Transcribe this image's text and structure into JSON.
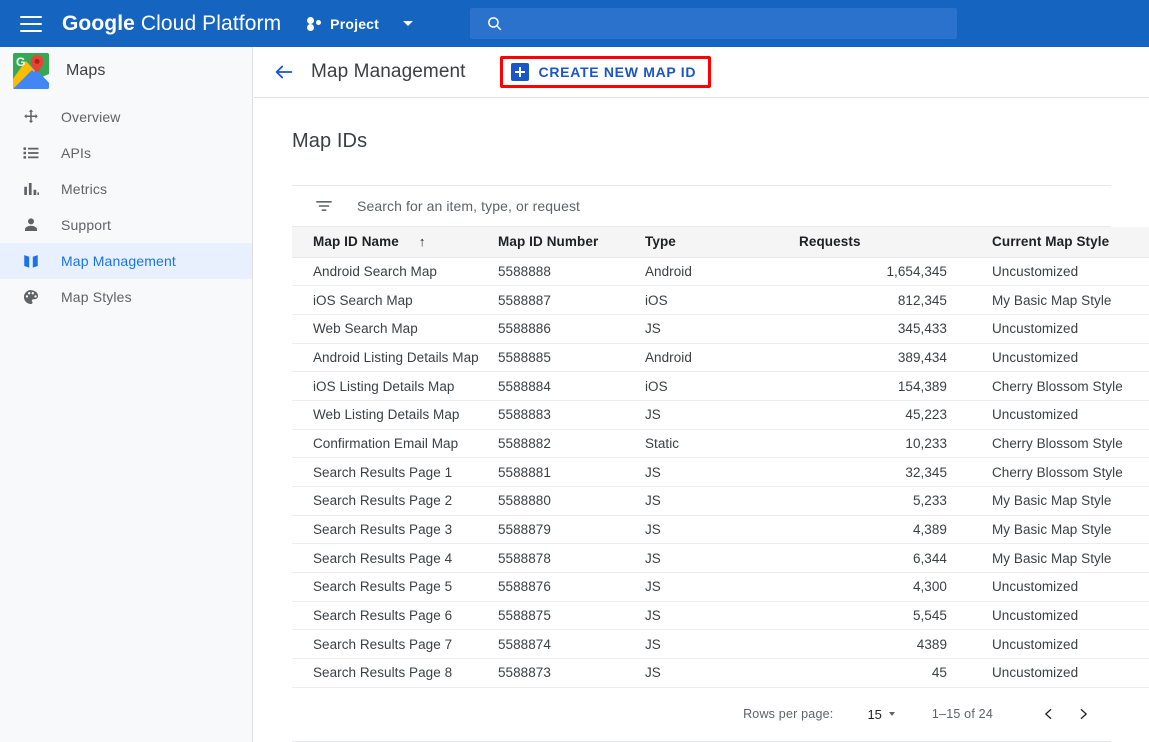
{
  "topbar": {
    "menu_icon": "hamburger-menu-icon",
    "brand_bold": "Google",
    "brand_normal": "Cloud Platform",
    "project_label": "Project",
    "project_icon": "project-dots-icon",
    "dropdown_icon": "caret-down-icon",
    "search_icon": "search-icon",
    "search_value": "",
    "search_placeholder": "",
    "bg_color": "#1565c0",
    "search_bg_color": "#2b72cd"
  },
  "sidebar": {
    "brand_label": "Maps",
    "brand_icon": "google-maps-logo-icon",
    "items": [
      {
        "label": "Overview",
        "icon": "overview-move-icon",
        "selected": false
      },
      {
        "label": "APIs",
        "icon": "list-icon",
        "selected": false
      },
      {
        "label": "Metrics",
        "icon": "bar-chart-icon",
        "selected": false
      },
      {
        "label": "Support",
        "icon": "person-icon",
        "selected": false
      },
      {
        "label": "Map Management",
        "icon": "map-icon",
        "selected": true
      },
      {
        "label": "Map Styles",
        "icon": "palette-icon",
        "selected": false
      }
    ],
    "selected_bg_color": "#e8f0fe",
    "selected_text_color": "#1a73e8",
    "bg_color": "#f8f9fa"
  },
  "page_header": {
    "back_icon": "back-arrow-icon",
    "title": "Map Management",
    "create_button_label": "CREATE NEW MAP ID",
    "create_button_icon": "plus-icon",
    "create_button_color": "#1a56c7",
    "highlight_color": "#ff0000"
  },
  "main": {
    "section_title": "Map IDs",
    "filter": {
      "icon": "filter-list-icon",
      "value": "",
      "placeholder": "Search for an item, type, or request"
    },
    "table": {
      "columns": [
        {
          "label": "Map ID Name",
          "sorted": true,
          "sort_icon": "sort-arrow-up-icon"
        },
        {
          "label": "Map ID Number",
          "sorted": false
        },
        {
          "label": "Type",
          "sorted": false
        },
        {
          "label": "Requests",
          "sorted": false
        },
        {
          "label": "Current Map Style",
          "sorted": false
        }
      ],
      "rows": [
        {
          "name": "Android Search Map",
          "number": "5588888",
          "type": "Android",
          "requests": "1,654,345",
          "style": "Uncustomized"
        },
        {
          "name": "iOS Search Map",
          "number": "5588887",
          "type": "iOS",
          "requests": "812,345",
          "style": "My Basic Map Style"
        },
        {
          "name": "Web Search Map",
          "number": "5588886",
          "type": "JS",
          "requests": "345,433",
          "style": "Uncustomized"
        },
        {
          "name": "Android Listing Details Map",
          "number": "5588885",
          "type": "Android",
          "requests": "389,434",
          "style": "Uncustomized"
        },
        {
          "name": "iOS Listing Details Map",
          "number": "5588884",
          "type": "iOS",
          "requests": "154,389",
          "style": "Cherry Blossom Style"
        },
        {
          "name": "Web Listing Details Map",
          "number": "5588883",
          "type": "JS",
          "requests": "45,223",
          "style": "Uncustomized"
        },
        {
          "name": "Confirmation Email Map",
          "number": "5588882",
          "type": "Static",
          "requests": "10,233",
          "style": "Cherry Blossom Style"
        },
        {
          "name": "Search Results Page 1",
          "number": "5588881",
          "type": "JS",
          "requests": "32,345",
          "style": "Cherry Blossom Style"
        },
        {
          "name": "Search Results Page 2",
          "number": "5588880",
          "type": "JS",
          "requests": "5,233",
          "style": "My Basic Map Style"
        },
        {
          "name": "Search Results Page 3",
          "number": "5588879",
          "type": "JS",
          "requests": "4,389",
          "style": "My Basic Map Style"
        },
        {
          "name": "Search Results Page 4",
          "number": "5588878",
          "type": "JS",
          "requests": "6,344",
          "style": "My Basic Map Style"
        },
        {
          "name": "Search Results Page 5",
          "number": "5588876",
          "type": "JS",
          "requests": "4,300",
          "style": "Uncustomized"
        },
        {
          "name": "Search Results Page 6",
          "number": "5588875",
          "type": "JS",
          "requests": "5,545",
          "style": "Uncustomized"
        },
        {
          "name": "Search Results Page 7",
          "number": "5588874",
          "type": "JS",
          "requests": "4389",
          "style": "Uncustomized"
        },
        {
          "name": "Search Results Page 8",
          "number": "5588873",
          "type": "JS",
          "requests": "45",
          "style": "Uncustomized"
        }
      ]
    },
    "pagination": {
      "rows_per_page_label": "Rows per page:",
      "rows_per_page_value": "15",
      "range_label": "1–15 of 24",
      "prev_icon": "chevron-left-icon",
      "next_icon": "chevron-right-icon"
    }
  }
}
